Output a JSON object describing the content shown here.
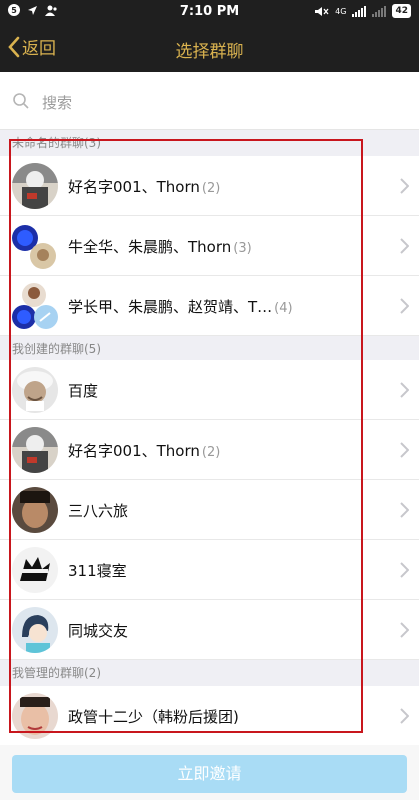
{
  "status_bar": {
    "left_badge": "5",
    "time": "7:10 PM",
    "network": "4G",
    "battery": "42"
  },
  "nav": {
    "back_label": "返回",
    "title": "选择群聊"
  },
  "search": {
    "placeholder": "搜索"
  },
  "sections": [
    {
      "header": "未命名的群聊(3)",
      "rows": [
        {
          "name": "好名字001、Thorn",
          "count": "(2)",
          "avatar": "portrait-avatar"
        },
        {
          "name": "牛全华、朱晨鹏、Thorn",
          "count": "(3)",
          "avatar": "composite-avatar"
        },
        {
          "name": "学长甲、朱晨鹏、赵贺靖、T…",
          "count": "(4)",
          "avatar": "composite-avatar"
        }
      ]
    },
    {
      "header": "我创建的群聊(5)",
      "rows": [
        {
          "name": "百度",
          "count": "",
          "avatar": "einstein-avatar"
        },
        {
          "name": "好名字001、Thorn",
          "count": "(2)",
          "avatar": "portrait-avatar"
        },
        {
          "name": "三八六旅",
          "count": "",
          "avatar": "face-avatar"
        },
        {
          "name": "311寝室",
          "count": "",
          "avatar": "wolf-avatar"
        },
        {
          "name": "同城交友",
          "count": "",
          "avatar": "cartoon-girl-avatar"
        }
      ]
    },
    {
      "header": "我管理的群聊(2)",
      "rows": [
        {
          "name": "政管十二少（韩粉后援团)",
          "count": "",
          "avatar": "person-avatar"
        }
      ]
    }
  ],
  "footer": {
    "invite_label": "立即邀请"
  },
  "colors": {
    "nav_bg": "#1f1f1f",
    "accent_gold": "#d9b24f",
    "highlight_red": "#c8161d",
    "button_disabled": "#a9dcf5"
  }
}
